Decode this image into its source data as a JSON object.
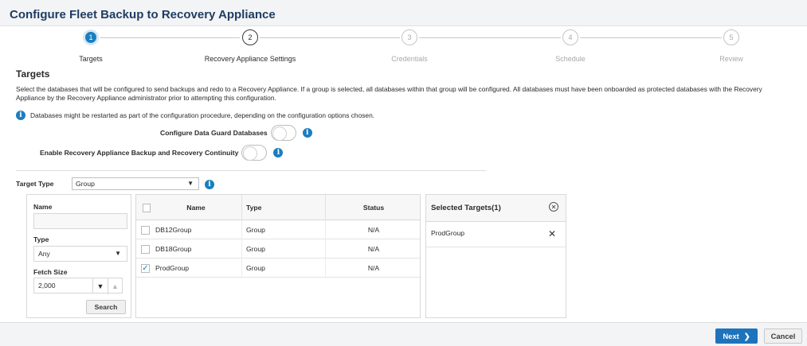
{
  "header": {
    "title": "Configure Fleet Backup to Recovery Appliance"
  },
  "train": {
    "steps": [
      {
        "number": "1",
        "label": "Targets"
      },
      {
        "number": "2",
        "label": "Recovery Appliance Settings"
      },
      {
        "number": "3",
        "label": "Credentials"
      },
      {
        "number": "4",
        "label": "Schedule"
      },
      {
        "number": "5",
        "label": "Review"
      }
    ]
  },
  "main": {
    "section_title": "Targets",
    "description": "Select the databases that will be configured to send backups and redo to a Recovery Appliance. If a group is selected, all databases within that group will be configured. All databases must have been onboarded as protected databases with the Recovery Appliance by the Recovery Appliance administrator prior to attempting this configuration.",
    "note": "Databases might be restarted as part of the configuration procedure, depending on the configuration options chosen.",
    "toggles": [
      {
        "label": "Configure Data Guard Databases"
      },
      {
        "label": "Enable Recovery Appliance Backup and Recovery Continuity"
      }
    ],
    "target_type": {
      "label": "Target Type",
      "value": "Group"
    }
  },
  "filters": {
    "name_label": "Name",
    "name_value": "",
    "type_label": "Type",
    "type_value": "Any",
    "fetch_label": "Fetch Size",
    "fetch_value": "2,000",
    "search_label": "Search"
  },
  "table": {
    "columns": [
      "Name",
      "Type",
      "Status"
    ],
    "rows": [
      {
        "name": "DB12Group",
        "type": "Group",
        "status": "N/A",
        "checked": false
      },
      {
        "name": "DB18Group",
        "type": "Group",
        "status": "N/A",
        "checked": false
      },
      {
        "name": "ProdGroup",
        "type": "Group",
        "status": "N/A",
        "checked": true
      }
    ]
  },
  "selected": {
    "title": "Selected Targets(1)",
    "items": [
      "ProdGroup"
    ]
  },
  "footer": {
    "next_label": "Next",
    "cancel_label": "Cancel"
  },
  "colors": {
    "accent": "#1a7ec0",
    "title": "#1f3d63",
    "next_button": "#1d74bd"
  }
}
